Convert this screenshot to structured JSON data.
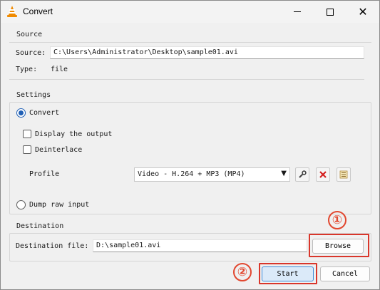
{
  "window": {
    "title": "Convert"
  },
  "source": {
    "group_label": "Source",
    "source_label": "Source:",
    "source_value": "C:\\Users\\Administrator\\Desktop\\sample01.avi",
    "type_label": "Type:",
    "type_value": "file"
  },
  "settings": {
    "group_label": "Settings",
    "convert_label": "Convert",
    "convert_selected": true,
    "display_output_label": "Display the output",
    "deinterlace_label": "Deinterlace",
    "profile_label": "Profile",
    "profile_value": "Video - H.264 + MP3 (MP4)",
    "dump_raw_label": "Dump raw input"
  },
  "destination": {
    "group_label": "Destination",
    "file_label": "Destination file:",
    "file_value": "D:\\sample01.avi",
    "browse_label": "Browse"
  },
  "footer": {
    "start_label": "Start",
    "cancel_label": "Cancel"
  },
  "annotations": {
    "step1": "①",
    "step2": "②",
    "color": "#e2472f"
  },
  "icons": {
    "app": "vlc-cone-icon",
    "edit_profile": "wrench-icon",
    "delete_profile": "red-x-icon",
    "new_profile": "list-icon"
  }
}
